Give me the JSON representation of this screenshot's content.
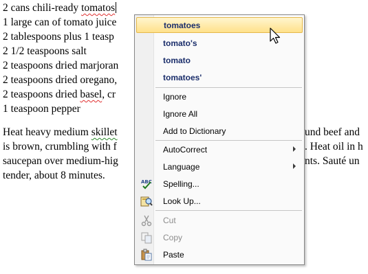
{
  "document": {
    "lines": [
      "2 cans chili-ready tomatos",
      "1 large can of tomato juice",
      "2 tablespoons plus 1 teasp",
      "2 1/2 teaspoons salt",
      "2 teaspoons dried marjoran",
      "2 teaspoons dried oregano,",
      "2 teaspoons dried basel, cr",
      "1 teaspoon pepper"
    ],
    "paragraph_left": [
      "Heat heavy medium  skillet",
      "is brown, crumbling with f",
      "saucepan over medium-hig",
      "tender, about 8 minutes."
    ],
    "paragraph_right": [
      "und beef and",
      ". Heat oil in h",
      "nts. Sauté un"
    ]
  },
  "context_menu": {
    "suggestions": [
      "tomatoes",
      "tomato's",
      "tomato",
      "tomatoes'"
    ],
    "ignore": "Ignore",
    "ignore_all": "Ignore All",
    "add_to_dictionary": "Add to Dictionary",
    "autocorrect": "AutoCorrect",
    "language": "Language",
    "spelling": "Spelling...",
    "look_up": "Look Up...",
    "cut": "Cut",
    "copy": "Copy",
    "paste": "Paste"
  }
}
